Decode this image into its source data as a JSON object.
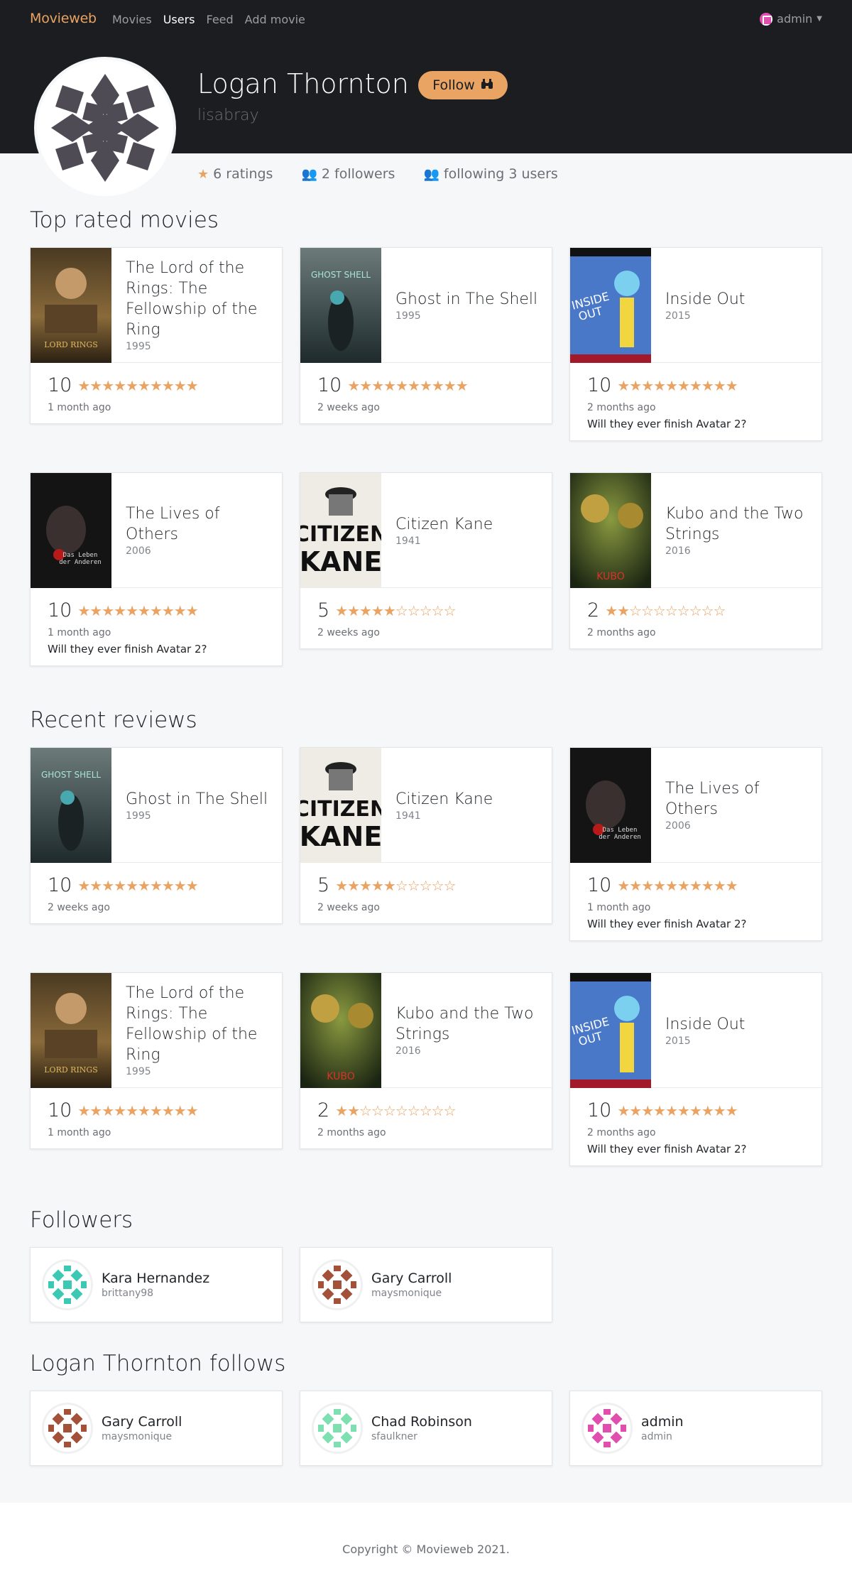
{
  "nav": {
    "brand": "Movieweb",
    "links": [
      "Movies",
      "Users",
      "Feed",
      "Add movie"
    ],
    "active": "Users",
    "user": "admin"
  },
  "profile": {
    "name": "Logan Thornton",
    "username": "lisabray",
    "follow_label": "Follow",
    "ratings": "6 ratings",
    "followers": "2 followers",
    "following": "following 3 users"
  },
  "sections": {
    "top_rated": "Top rated movies",
    "recent_reviews": "Recent reviews",
    "followers": "Followers",
    "follows": "Logan Thornton follows"
  },
  "top_rated": [
    {
      "title": "The Lord of the Rings: The Fellowship of the Ring",
      "year": "1995",
      "rating": "10",
      "stars": 10,
      "ago": "1 month ago",
      "comment": "",
      "poster": "lotr"
    },
    {
      "title": "Ghost in The Shell",
      "year": "1995",
      "rating": "10",
      "stars": 10,
      "ago": "2 weeks ago",
      "comment": "",
      "poster": "ghost"
    },
    {
      "title": "Inside Out",
      "year": "2015",
      "rating": "10",
      "stars": 10,
      "ago": "2 months ago",
      "comment": "Will they ever finish Avatar 2?",
      "poster": "inside"
    },
    {
      "title": "The Lives of Others",
      "year": "2006",
      "rating": "10",
      "stars": 10,
      "ago": "1 month ago",
      "comment": "Will they ever finish Avatar 2?",
      "poster": "lives"
    },
    {
      "title": "Citizen Kane",
      "year": "1941",
      "rating": "5",
      "stars": 5,
      "ago": "2 weeks ago",
      "comment": "",
      "poster": "kane"
    },
    {
      "title": "Kubo and the Two Strings",
      "year": "2016",
      "rating": "2",
      "stars": 2,
      "ago": "2 months ago",
      "comment": "",
      "poster": "kubo"
    }
  ],
  "recent": [
    {
      "title": "Ghost in The Shell",
      "year": "1995",
      "rating": "10",
      "stars": 10,
      "ago": "2 weeks ago",
      "comment": "",
      "poster": "ghost"
    },
    {
      "title": "Citizen Kane",
      "year": "1941",
      "rating": "5",
      "stars": 5,
      "ago": "2 weeks ago",
      "comment": "",
      "poster": "kane"
    },
    {
      "title": "The Lives of Others",
      "year": "2006",
      "rating": "10",
      "stars": 10,
      "ago": "1 month ago",
      "comment": "Will they ever finish Avatar 2?",
      "poster": "lives"
    },
    {
      "title": "The Lord of the Rings: The Fellowship of the Ring",
      "year": "1995",
      "rating": "10",
      "stars": 10,
      "ago": "1 month ago",
      "comment": "",
      "poster": "lotr"
    },
    {
      "title": "Kubo and the Two Strings",
      "year": "2016",
      "rating": "2",
      "stars": 2,
      "ago": "2 months ago",
      "comment": "",
      "poster": "kubo"
    },
    {
      "title": "Inside Out",
      "year": "2015",
      "rating": "10",
      "stars": 10,
      "ago": "2 months ago",
      "comment": "Will they ever finish Avatar 2?",
      "poster": "inside"
    }
  ],
  "followers": [
    {
      "name": "Kara Hernandez",
      "handle": "brittany98",
      "color": "#3cc9b4"
    },
    {
      "name": "Gary Carroll",
      "handle": "maysmonique",
      "color": "#a4513a"
    }
  ],
  "follows": [
    {
      "name": "Gary Carroll",
      "handle": "maysmonique",
      "color": "#a4513a"
    },
    {
      "name": "Chad Robinson",
      "handle": "sfaulkner",
      "color": "#7ee0b0"
    },
    {
      "name": "admin",
      "handle": "admin",
      "color": "#e04fae"
    }
  ],
  "footer": "Copyright © Movieweb 2021."
}
